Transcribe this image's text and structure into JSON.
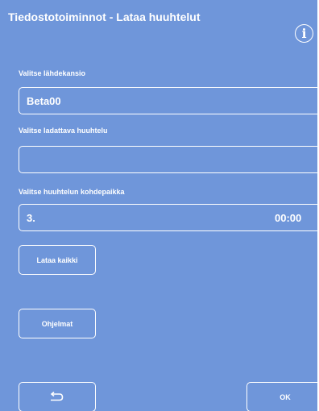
{
  "header": {
    "title": "Tiedostotoiminnot - Lataa huuhtelut",
    "info_icon": "info-circle-icon",
    "info_glyph": "i"
  },
  "source_folder": {
    "label": "Valitse lähdekansio",
    "value": "Beta00"
  },
  "rinse_to_load": {
    "label": "Valitse ladattava huuhtelu",
    "value": ""
  },
  "destination": {
    "label": "Valitse huuhtelun kohdepaikka",
    "slot": "3.",
    "time": "00:00"
  },
  "buttons": {
    "load_all": "Lataa kaikki",
    "programs": "Ohjelmat",
    "back_icon": "return-arrow-icon",
    "ok": "OK"
  },
  "colors": {
    "background": "#6f96da",
    "foreground": "#ffffff"
  }
}
